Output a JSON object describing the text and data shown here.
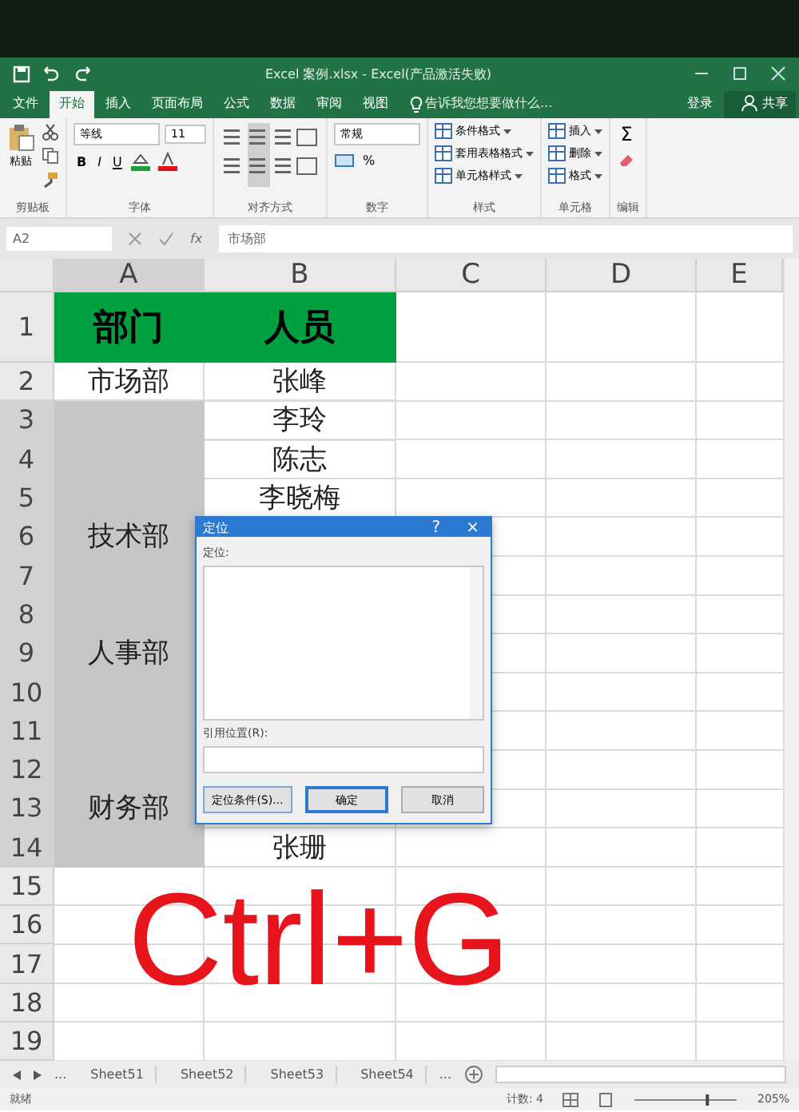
{
  "window": {
    "title": "Excel 案例.xlsx - Excel(产品激活失败)"
  },
  "ribbon_tabs": [
    {
      "label": "文件",
      "selected": false
    },
    {
      "label": "开始",
      "selected": true
    },
    {
      "label": "插入",
      "selected": false
    },
    {
      "label": "页面布局",
      "selected": false
    },
    {
      "label": "公式",
      "selected": false
    },
    {
      "label": "数据",
      "selected": false
    },
    {
      "label": "审阅",
      "selected": false
    },
    {
      "label": "视图",
      "selected": false
    }
  ],
  "tell_me": "告诉我您想要做什么...",
  "sign_in": "登录",
  "share": "共享",
  "ribbon_groups": [
    {
      "label": "剪贴板",
      "kind": "clipboard",
      "items": [
        "粘贴"
      ]
    },
    {
      "label": "字体",
      "kind": "font",
      "font": "等线",
      "size": "11",
      "items": [
        "B",
        "I",
        "U"
      ]
    },
    {
      "label": "对齐方式",
      "kind": "alignment"
    },
    {
      "label": "数字",
      "kind": "number",
      "format": "常规",
      "items": [
        "%"
      ]
    },
    {
      "label": "样式",
      "kind": "styles",
      "items": [
        "条件格式",
        "套用表格格式",
        "单元格样式"
      ]
    },
    {
      "label": "单元格",
      "kind": "cells",
      "items": [
        "插入",
        "删除",
        "格式"
      ]
    },
    {
      "label": "编辑",
      "kind": "editing",
      "items": [
        "Σ"
      ]
    }
  ],
  "formula_bar": {
    "name_box": "A2",
    "function_label": "fx",
    "content": "市场部"
  },
  "sheet": {
    "columns": [
      "A",
      "B",
      "C",
      "D",
      "E"
    ],
    "rows": [
      {
        "number": "1",
        "kind": "header",
        "a": "部门",
        "b": "人员"
      },
      {
        "number": "2",
        "kind": "data",
        "a": "市场部",
        "b": "张峰",
        "a_selected": false
      },
      {
        "number": "3",
        "kind": "data",
        "b": "李玲",
        "a_selected": true
      },
      {
        "number": "4",
        "kind": "data",
        "b": "陈志",
        "a_selected": true
      },
      {
        "number": "5",
        "kind": "data",
        "b": "李晓梅",
        "a_selected": true
      },
      {
        "number": "6",
        "kind": "data",
        "a": "技术部",
        "a_selected": true
      },
      {
        "number": "7",
        "kind": "data",
        "a_selected": true
      },
      {
        "number": "8",
        "kind": "data",
        "a_selected": true
      },
      {
        "number": "9",
        "kind": "data",
        "a": "人事部",
        "a_selected": true
      },
      {
        "number": "10",
        "kind": "data",
        "a_selected": true
      },
      {
        "number": "11",
        "kind": "data",
        "a_selected": true
      },
      {
        "number": "12",
        "kind": "data",
        "a_selected": true
      },
      {
        "number": "13",
        "kind": "data",
        "a": "财务部",
        "a_selected": true
      },
      {
        "number": "14",
        "kind": "data",
        "b": "张珊",
        "a_selected": true
      },
      {
        "number": "15",
        "kind": "data",
        "a_selected": false
      },
      {
        "number": "16",
        "kind": "data",
        "a_selected": false
      },
      {
        "number": "17",
        "kind": "data",
        "a_selected": false
      },
      {
        "number": "18",
        "kind": "data",
        "a_selected": false
      },
      {
        "number": "19",
        "kind": "data",
        "a_selected": false
      }
    ]
  },
  "dialog": {
    "title": "定位",
    "help": "?",
    "close": "×",
    "list_label": "定位:",
    "reference_label": "引用位置(R):",
    "buttons": [
      {
        "label": "定位条件(S)...",
        "kind": "special"
      },
      {
        "label": "确定",
        "kind": "default"
      },
      {
        "label": "取消",
        "kind": "normal"
      }
    ]
  },
  "caption": "Ctrl+G",
  "sheet_tabs": {
    "more": "...",
    "tabs": [
      "Sheet51",
      "Sheet52",
      "Sheet53",
      "Sheet54"
    ],
    "more_after": "..."
  },
  "status_bar": {
    "status": "就绪",
    "count": "计数: 4",
    "zoom_slider": {
      "level": 0.72
    },
    "zoom": "205%"
  }
}
